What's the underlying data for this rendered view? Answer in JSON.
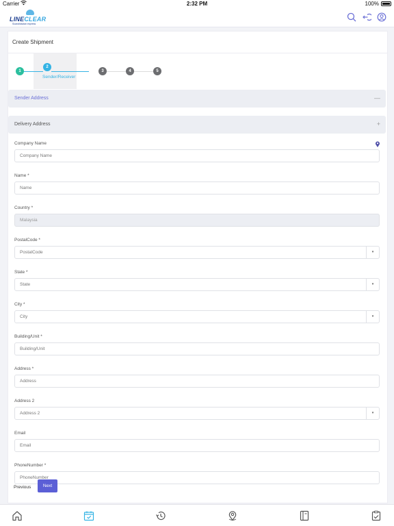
{
  "status_bar": {
    "carrier": "Carrier",
    "time": "2:32 PM",
    "battery": "100%"
  },
  "header": {
    "logo_primary": "LINE",
    "logo_secondary": "CLEAR",
    "logo_tagline": "Scandinavian express",
    "icons": [
      "search-icon",
      "logout-icon",
      "user-icon"
    ],
    "accent_color": "#6a6fd6"
  },
  "card": {
    "title": "Create Shipment"
  },
  "steps": [
    {
      "number": "1",
      "state": "done"
    },
    {
      "number": "2",
      "state": "active",
      "label": "Sender/Receiver"
    },
    {
      "number": "3",
      "state": "pending"
    },
    {
      "number": "4",
      "state": "pending"
    },
    {
      "number": "5",
      "state": "pending"
    }
  ],
  "sections": {
    "sender": {
      "title": "Sender Address",
      "toggle": "—"
    },
    "delivery": {
      "title": "Delivery Address",
      "toggle": "+"
    }
  },
  "fields": {
    "company": {
      "label": "Company Name",
      "placeholder": "Company Name"
    },
    "name": {
      "label": "Name *",
      "placeholder": "Name"
    },
    "country": {
      "label": "Country *",
      "value": "Malaysia"
    },
    "postal": {
      "label": "PostalCode *",
      "placeholder": "PostalCode"
    },
    "state": {
      "label": "State *",
      "placeholder": "State"
    },
    "city": {
      "label": "City *",
      "placeholder": "City"
    },
    "building": {
      "label": "Building/Unit *",
      "placeholder": "Building/Unit"
    },
    "address": {
      "label": "Address *",
      "placeholder": "Address"
    },
    "address2": {
      "label": "Address 2",
      "placeholder": "Address 2"
    },
    "email": {
      "label": "Email",
      "placeholder": "Email"
    },
    "phone": {
      "label": "PhoneNumber *",
      "placeholder": "PhoneNumber"
    }
  },
  "dropdown_caret": "▾",
  "buttons": {
    "previous": "Previous",
    "next": "Next"
  },
  "tabbar": {
    "tabs": [
      "home-icon",
      "calendar-check-icon",
      "history-icon",
      "location-pin-icon",
      "document-icon",
      "clipboard-icon"
    ],
    "active_index": 1,
    "active_color": "#34b3e4"
  }
}
